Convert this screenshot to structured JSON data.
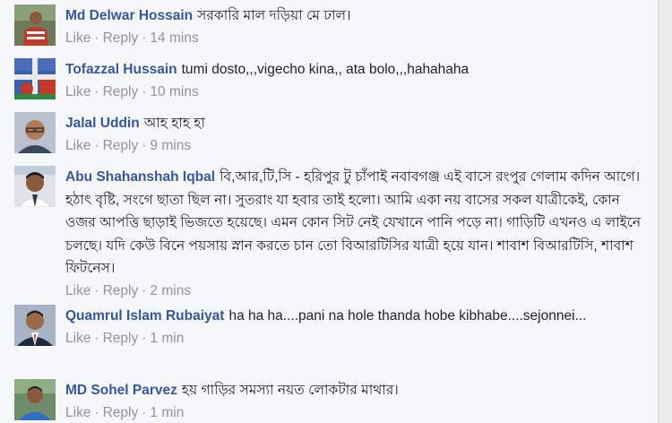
{
  "comments": [
    {
      "author": "Md Delwar Hossain",
      "text": "সরকারি মাল দড়িয়া মে ঢাল।",
      "like_label": "Like",
      "reply_label": "Reply",
      "time": "14 mins",
      "avatar": "person-red-shirt"
    },
    {
      "author": "Tofazzal Hussain",
      "text": "tumi dosto,,,vigecho kina,, ata bolo,,,hahahaha",
      "like_label": "Like",
      "reply_label": "Reply",
      "time": "10 mins",
      "avatar": "flag-graphic"
    },
    {
      "author": "Jalal Uddin",
      "text": "আহ হাহ হা",
      "like_label": "Like",
      "reply_label": "Reply",
      "time": "9 mins",
      "avatar": "man-glasses"
    },
    {
      "author": "Abu Shahanshah Iqbal",
      "text": "বি,আর,টি,সি - হরিপুর টু চাঁপাই নবাবগঞ্জ এই বাসে রংপুর গেলাম কদিন আগে। হঠাৎ বৃষ্টি, সংগে ছাতা ছিল না। সুতরাং যা হবার তাই হলো। আমি একা নয় বাসের সকল যাত্রীকেই, কোন ওজর আপত্তি ছাড়াই ভিজতে হয়েছে। এমন কোন সিট নেই যেখানে পানি পড়ে না। গাড়িটি এখনও এ লাইনে চলছে। যদি কেউ বিনে পয়সায় স্নান করতে চান তো বিআরটিসির যাত্রী হয়ে যান। শাবাশ বিআরটিসি, শাবাশ ফিটনেস।",
      "like_label": "Like",
      "reply_label": "Reply",
      "time": "2 mins",
      "avatar": "man-portrait"
    },
    {
      "author": "Quamrul Islam Rubaiyat",
      "text": "ha ha ha....pani na hole thanda hobe kibhabe....sejonnei...",
      "like_label": "Like",
      "reply_label": "Reply",
      "time": "1 min",
      "avatar": "man-suit"
    },
    {
      "author": "MD Sohel Parvez",
      "text": "হয় গাড়ির সমস্যা নয়ত লোকটার মাথার।",
      "like_label": "Like",
      "reply_label": "Reply",
      "time": "1 min",
      "avatar": "man-blue-shirt"
    }
  ]
}
